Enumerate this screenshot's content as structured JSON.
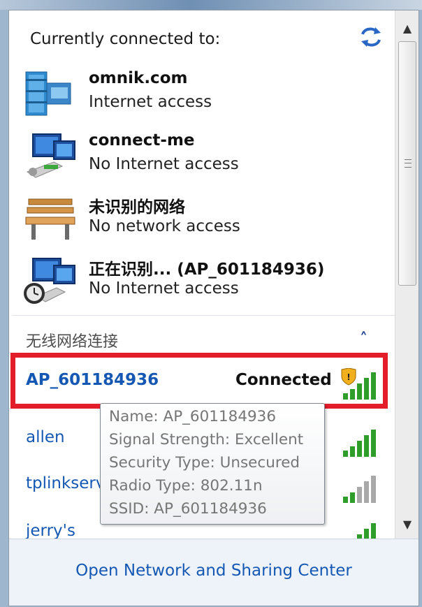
{
  "header": {
    "title": "Currently connected to:"
  },
  "connected_networks": [
    {
      "name": "omnik.com",
      "status": "Internet access",
      "icon": "domain-network-icon"
    },
    {
      "name": "connect-me",
      "status": "No Internet access",
      "icon": "network-computer-icon"
    },
    {
      "name": "未识别的网络",
      "status": "No network access",
      "icon": "park-bench-icon"
    },
    {
      "name": "正在识别... (AP_601184936)",
      "status": "No Internet access",
      "icon": "identifying-network-icon"
    }
  ],
  "wireless_section": {
    "label": "无线网络连接",
    "collapse_glyph": "˄"
  },
  "wireless_networks": [
    {
      "ssid": "AP_601184936",
      "status": "Connected",
      "bold": true,
      "signal_bars": 5,
      "secured_shield": true
    },
    {
      "ssid": "allen",
      "status": "",
      "signal_bars": 5
    },
    {
      "ssid": "tplinkserver",
      "status": "",
      "signal_bars": 2
    },
    {
      "ssid": "jerry's",
      "status": "",
      "signal_bars": 5
    }
  ],
  "tooltip": {
    "lines": [
      "Name: AP_601184936",
      "Signal Strength: Excellent",
      "Security Type: Unsecured",
      "Radio Type: 802.11n",
      "SSID: AP_601184936"
    ]
  },
  "scrollbar": {
    "up_glyph": "▲",
    "down_glyph": "▼"
  },
  "footer": {
    "link": "Open Network and Sharing Center"
  },
  "colors": {
    "link": "#1558b3",
    "highlight_border": "#e41d2a",
    "signal_on": "#2e9d2a",
    "signal_off": "#a9a9a9"
  }
}
